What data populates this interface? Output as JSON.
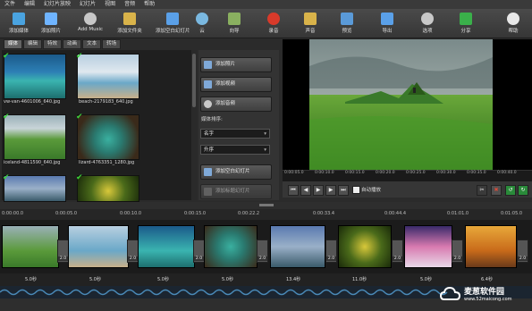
{
  "menu": [
    "文件",
    "编辑",
    "幻灯片放映",
    "幻灯片",
    "视图",
    "音频",
    "帮助"
  ],
  "toolbar": [
    {
      "label": "添加媒体",
      "icon": "add-media-icon",
      "color": "#4aa3e0"
    },
    {
      "label": "添加照片",
      "icon": "add-photo-icon",
      "color": "#6fb4ff"
    },
    {
      "label": "Add Music",
      "icon": "music-icon",
      "color": "#c8c8c8"
    },
    {
      "label": "添加文件夹",
      "icon": "folder-icon",
      "color": "#d9b34a"
    },
    {
      "label": "添加空白幻灯片",
      "icon": "blank-slide-icon",
      "color": "#5aa0e8"
    },
    {
      "label": "云",
      "icon": "cloud-icon",
      "color": "#7ab8e0"
    },
    {
      "label": "向导",
      "icon": "wizard-icon",
      "color": "#8ab060"
    },
    {
      "label": "录音",
      "icon": "record-icon",
      "color": "#d83a2a"
    },
    {
      "label": "声音",
      "icon": "sound-icon",
      "color": "#d9b34a"
    },
    {
      "label": "预览",
      "icon": "preview-icon",
      "color": "#5a9ad8"
    },
    {
      "label": "导出",
      "icon": "export-icon",
      "color": "#5aa0e8"
    },
    {
      "label": "选项",
      "icon": "options-icon",
      "color": "#c8c8c8"
    },
    {
      "label": "分享",
      "icon": "share-icon",
      "color": "#3ab04a"
    },
    {
      "label": "帮助",
      "icon": "help-icon",
      "color": "#e8e8e8"
    }
  ],
  "tabs": [
    "媒体",
    "编辑",
    "特效",
    "动画",
    "文本",
    "转场"
  ],
  "media": [
    {
      "caption": "vw-van-4601006_640.jpg"
    },
    {
      "caption": "beach-2179183_640.jpg"
    },
    {
      "caption": "iceland-4811590_640.jpg"
    },
    {
      "caption": "lizard-4763351_1280.jpg"
    },
    {
      "caption": ""
    },
    {
      "caption": ""
    }
  ],
  "side": {
    "add_photo": "添加照片",
    "add_video": "添加视频",
    "add_audio": "添加音频",
    "sort_label": "媒体排序:",
    "sort_value": "名字",
    "order_value": "升序",
    "add_blank": "添加空白幻灯片",
    "add_text": "添加标题幻灯片"
  },
  "preview_ruler": [
    "0:00:05.0",
    "0:00:10.0",
    "0:00:15.0",
    "0:00:20.0",
    "0:00:25.0",
    "0:00:30.0",
    "0:00:35.0",
    "0:00:40.0"
  ],
  "autoplay": "自动播放",
  "timeline_ruler": [
    "0:00:00.0",
    "0:00:05.0",
    "0:00:10.0",
    "0:00:15.0",
    "0:00:22.2",
    "0:00:33.4",
    "0:00:44.4",
    "0:01:01.0",
    "0:01:05.0"
  ],
  "transitions": [
    "2.0",
    "2.0",
    "2.0",
    "2.0",
    "2.0",
    "2.0",
    "2.0",
    "2.0"
  ],
  "durations": [
    "5.0秒",
    "5.0秒",
    "5.0秒",
    "5.0秒",
    "13.4秒",
    "11.0秒",
    "5.0秒",
    "6.4秒"
  ],
  "watermark": {
    "name": "麦葱软件园",
    "url": "www.52maicong.com"
  }
}
